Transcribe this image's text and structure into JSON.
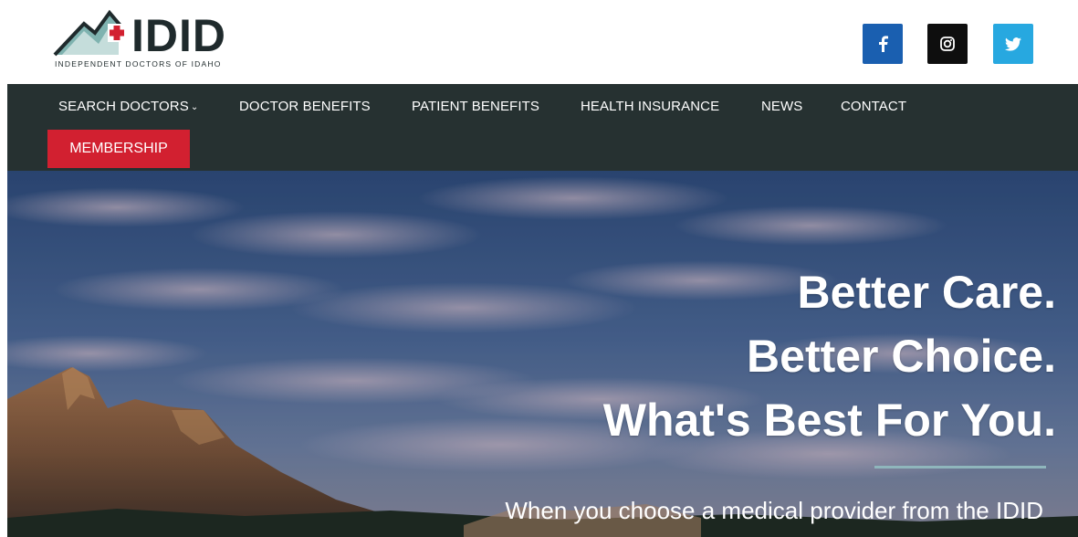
{
  "brand": {
    "logo_text": "IDID",
    "tagline": "INDEPENDENT DOCTORS OF IDAHO",
    "colors": {
      "dark": "#1f2a2c",
      "teal": "#7fb3b0",
      "red": "#d22030"
    }
  },
  "social": [
    {
      "name": "facebook",
      "icon": "f",
      "color": "#1a5fb0"
    },
    {
      "name": "instagram",
      "icon": "instagram-icon",
      "color": "#0e0e0e"
    },
    {
      "name": "twitter",
      "icon": "bird",
      "color": "#27a8e0"
    }
  ],
  "nav": {
    "items": [
      {
        "label": "SEARCH DOCTORS",
        "has_dropdown": true
      },
      {
        "label": "DOCTOR BENEFITS"
      },
      {
        "label": "PATIENT BENEFITS"
      },
      {
        "label": "HEALTH INSURANCE"
      },
      {
        "label": "NEWS"
      },
      {
        "label": "CONTACT"
      }
    ],
    "membership_label": "MEMBERSHIP",
    "background": "#263131",
    "accent": "#d22030"
  },
  "hero": {
    "line1": "Better Care.",
    "line2": "Better Choice.",
    "line3": "What's Best For You.",
    "subtext": "When you choose a medical provider from the IDID"
  }
}
